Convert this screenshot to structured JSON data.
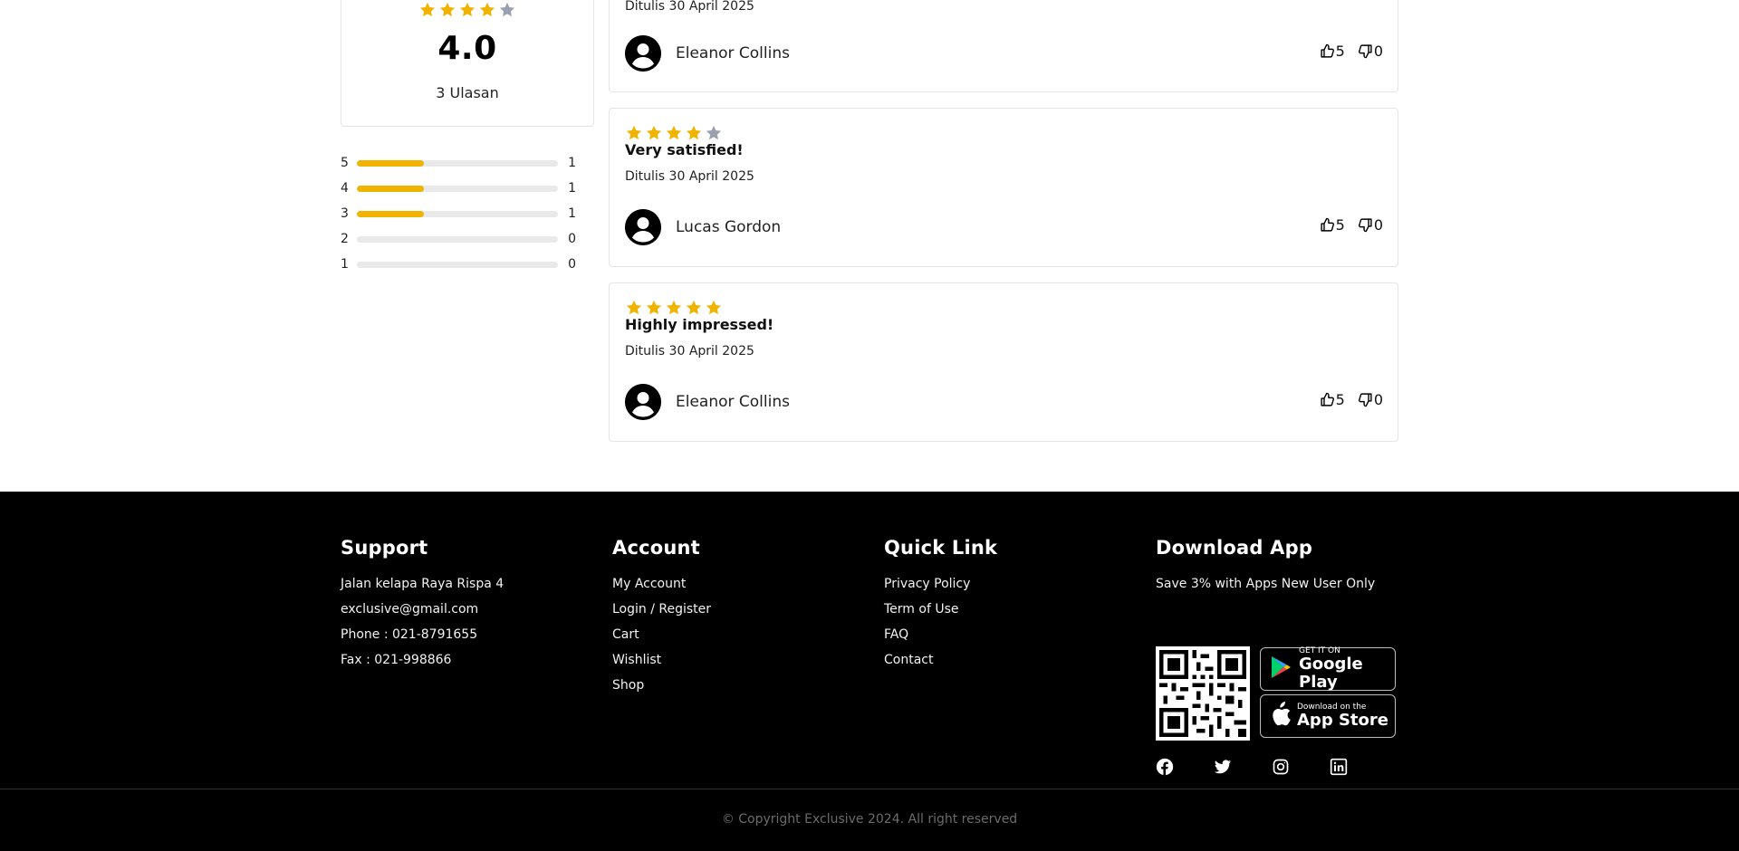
{
  "colors": {
    "star_filled": "#F0B400",
    "star_empty": "#9AA0AD",
    "bar_fill": "#F0B400",
    "bar_track": "#E9E9E9",
    "footer_bg": "#000000"
  },
  "summary": {
    "rating": "4.0",
    "stars": 4,
    "review_count_label": "3 Ulasan",
    "distribution": [
      {
        "star": "5",
        "count": "1",
        "fraction": 0.333
      },
      {
        "star": "4",
        "count": "1",
        "fraction": 0.333
      },
      {
        "star": "3",
        "count": "1",
        "fraction": 0.333
      },
      {
        "star": "2",
        "count": "0",
        "fraction": 0
      },
      {
        "star": "1",
        "count": "0",
        "fraction": 0
      }
    ]
  },
  "reviews": [
    {
      "stars": null,
      "title": "",
      "date": "Ditulis 30 April 2025",
      "author": "Eleanor Collins",
      "likes": "5",
      "dislikes": "0"
    },
    {
      "stars": 4,
      "title": "Very satisfied!",
      "date": "Ditulis 30 April 2025",
      "author": "Lucas Gordon",
      "likes": "5",
      "dislikes": "0"
    },
    {
      "stars": 5,
      "title": "Highly impressed!",
      "date": "Ditulis 30 April 2025",
      "author": "Eleanor Collins",
      "likes": "5",
      "dislikes": "0"
    }
  ],
  "footer": {
    "support": {
      "title": "Support",
      "address": "Jalan kelapa Raya Rispa 4",
      "email": "exclusive@gmail.com",
      "phone": "Phone : 021-8791655",
      "fax": "Fax : 021-998866"
    },
    "account": {
      "title": "Account",
      "links": [
        "My Account",
        "Login / Register",
        "Cart",
        "Wishlist",
        "Shop"
      ]
    },
    "quick_link": {
      "title": "Quick Link",
      "links": [
        "Privacy Policy",
        "Term of Use",
        "FAQ",
        "Contact"
      ]
    },
    "download": {
      "title": "Download App",
      "promo": "Save 3% with Apps New User Only",
      "google_small": "GET IT ON",
      "google_big": "Google Play",
      "apple_small": "Download on the",
      "apple_big": "App Store",
      "socials": [
        "facebook-icon",
        "twitter-icon",
        "instagram-icon",
        "linkedin-icon"
      ]
    },
    "copyright": "© Copyright Exclusive 2024. All right reserved"
  }
}
